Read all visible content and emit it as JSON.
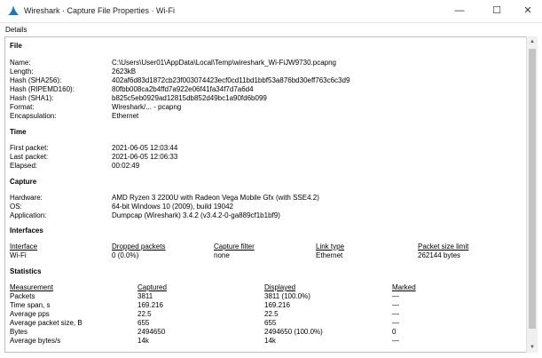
{
  "window": {
    "title": "Wireshark · Capture File Properties · Wi-Fi",
    "minimize": "—",
    "maximize": "☐",
    "close": "✕"
  },
  "menu": {
    "details": "Details"
  },
  "file": {
    "heading": "File",
    "rows": [
      {
        "k": "Name:",
        "v": "C:\\Users\\User01\\AppData\\Local\\Temp\\wireshark_Wi-FiJW9730.pcapng"
      },
      {
        "k": "Length:",
        "v": "2623kB"
      },
      {
        "k": "Hash (SHA256):",
        "v": "402af6d83d1872cb23f003074423ecf0cd11bd1bbf53a876bd30eff763c6c3d9"
      },
      {
        "k": "Hash (RIPEMD160):",
        "v": "80fbb008ca2b4ffd7a922e06f41fa34f7d7a6d4"
      },
      {
        "k": "Hash (SHA1):",
        "v": "b825c5eb0929ad12815db852d49bc1a90fd6b099"
      },
      {
        "k": "Format:",
        "v": "Wireshark/... - pcapng"
      },
      {
        "k": "Encapsulation:",
        "v": "Ethernet"
      }
    ]
  },
  "time": {
    "heading": "Time",
    "rows": [
      {
        "k": "First packet:",
        "v": "2021-06-05 12:03:44"
      },
      {
        "k": "Last packet:",
        "v": "2021-06-05 12:06:33"
      },
      {
        "k": "Elapsed:",
        "v": "00:02:49"
      }
    ]
  },
  "capture": {
    "heading": "Capture",
    "rows": [
      {
        "k": "Hardware:",
        "v": "AMD Ryzen 3 2200U with Radeon Vega Mobile Gfx (with SSE4.2)"
      },
      {
        "k": "OS:",
        "v": "64-bit Windows 10 (2009), build 19042"
      },
      {
        "k": "Application:",
        "v": "Dumpcap (Wireshark) 3.4.2 (v3.4.2-0-ga889cf1b1bf9)"
      }
    ]
  },
  "interfaces": {
    "heading": "Interfaces",
    "headers": [
      "Interface",
      "Dropped packets",
      "Capture filter",
      "Link type",
      "Packet size limit"
    ],
    "rows": [
      [
        "Wi-Fi",
        "0 (0.0%)",
        "none",
        "Ethernet",
        "262144 bytes"
      ]
    ]
  },
  "statistics": {
    "heading": "Statistics",
    "headers": [
      "Measurement",
      "Captured",
      "Displayed",
      "Marked"
    ],
    "rows": [
      [
        "Packets",
        "3811",
        "3811 (100.0%)",
        "—"
      ],
      [
        "Time span, s",
        "169.216",
        "169.216",
        "—"
      ],
      [
        "Average pps",
        "22.5",
        "22.5",
        "—"
      ],
      [
        "Average packet size, B",
        "655",
        "655",
        "—"
      ],
      [
        "Bytes",
        "2494650",
        "2494650 (100.0%)",
        "0"
      ],
      [
        "Average bytes/s",
        "14k",
        "14k",
        "—"
      ]
    ]
  },
  "colors": {
    "shark_fin": "#1679c5"
  }
}
